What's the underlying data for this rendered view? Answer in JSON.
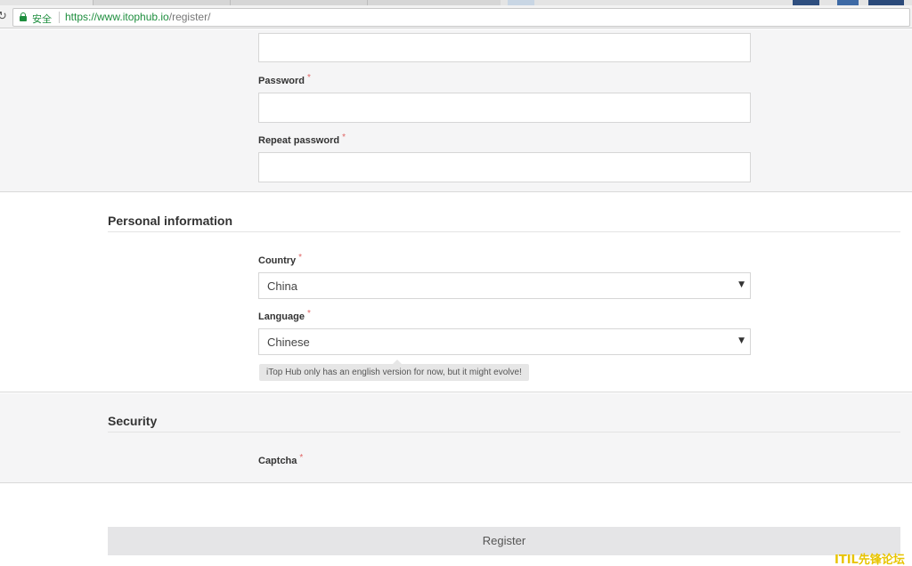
{
  "browser": {
    "security_label": "安全",
    "url_host": "https://www.itophub.io",
    "url_path": "/register/"
  },
  "account": {
    "password_label": "Password",
    "repeat_password_label": "Repeat password",
    "required_mark": "*"
  },
  "personal": {
    "title": "Personal information",
    "country_label": "Country",
    "country_value": "China",
    "language_label": "Language",
    "language_value": "Chinese",
    "language_hint": "iTop Hub only has an english version for now, but it might evolve!"
  },
  "security": {
    "title": "Security",
    "captcha_label": "Captcha"
  },
  "form": {
    "register_label": "Register"
  },
  "watermark": "ITIL先锋论坛",
  "colors": {
    "secure_green": "#1e8e3e",
    "required_red": "#e06666",
    "section_gray": "#f5f5f6",
    "watermark_yellow": "#e8c400"
  }
}
